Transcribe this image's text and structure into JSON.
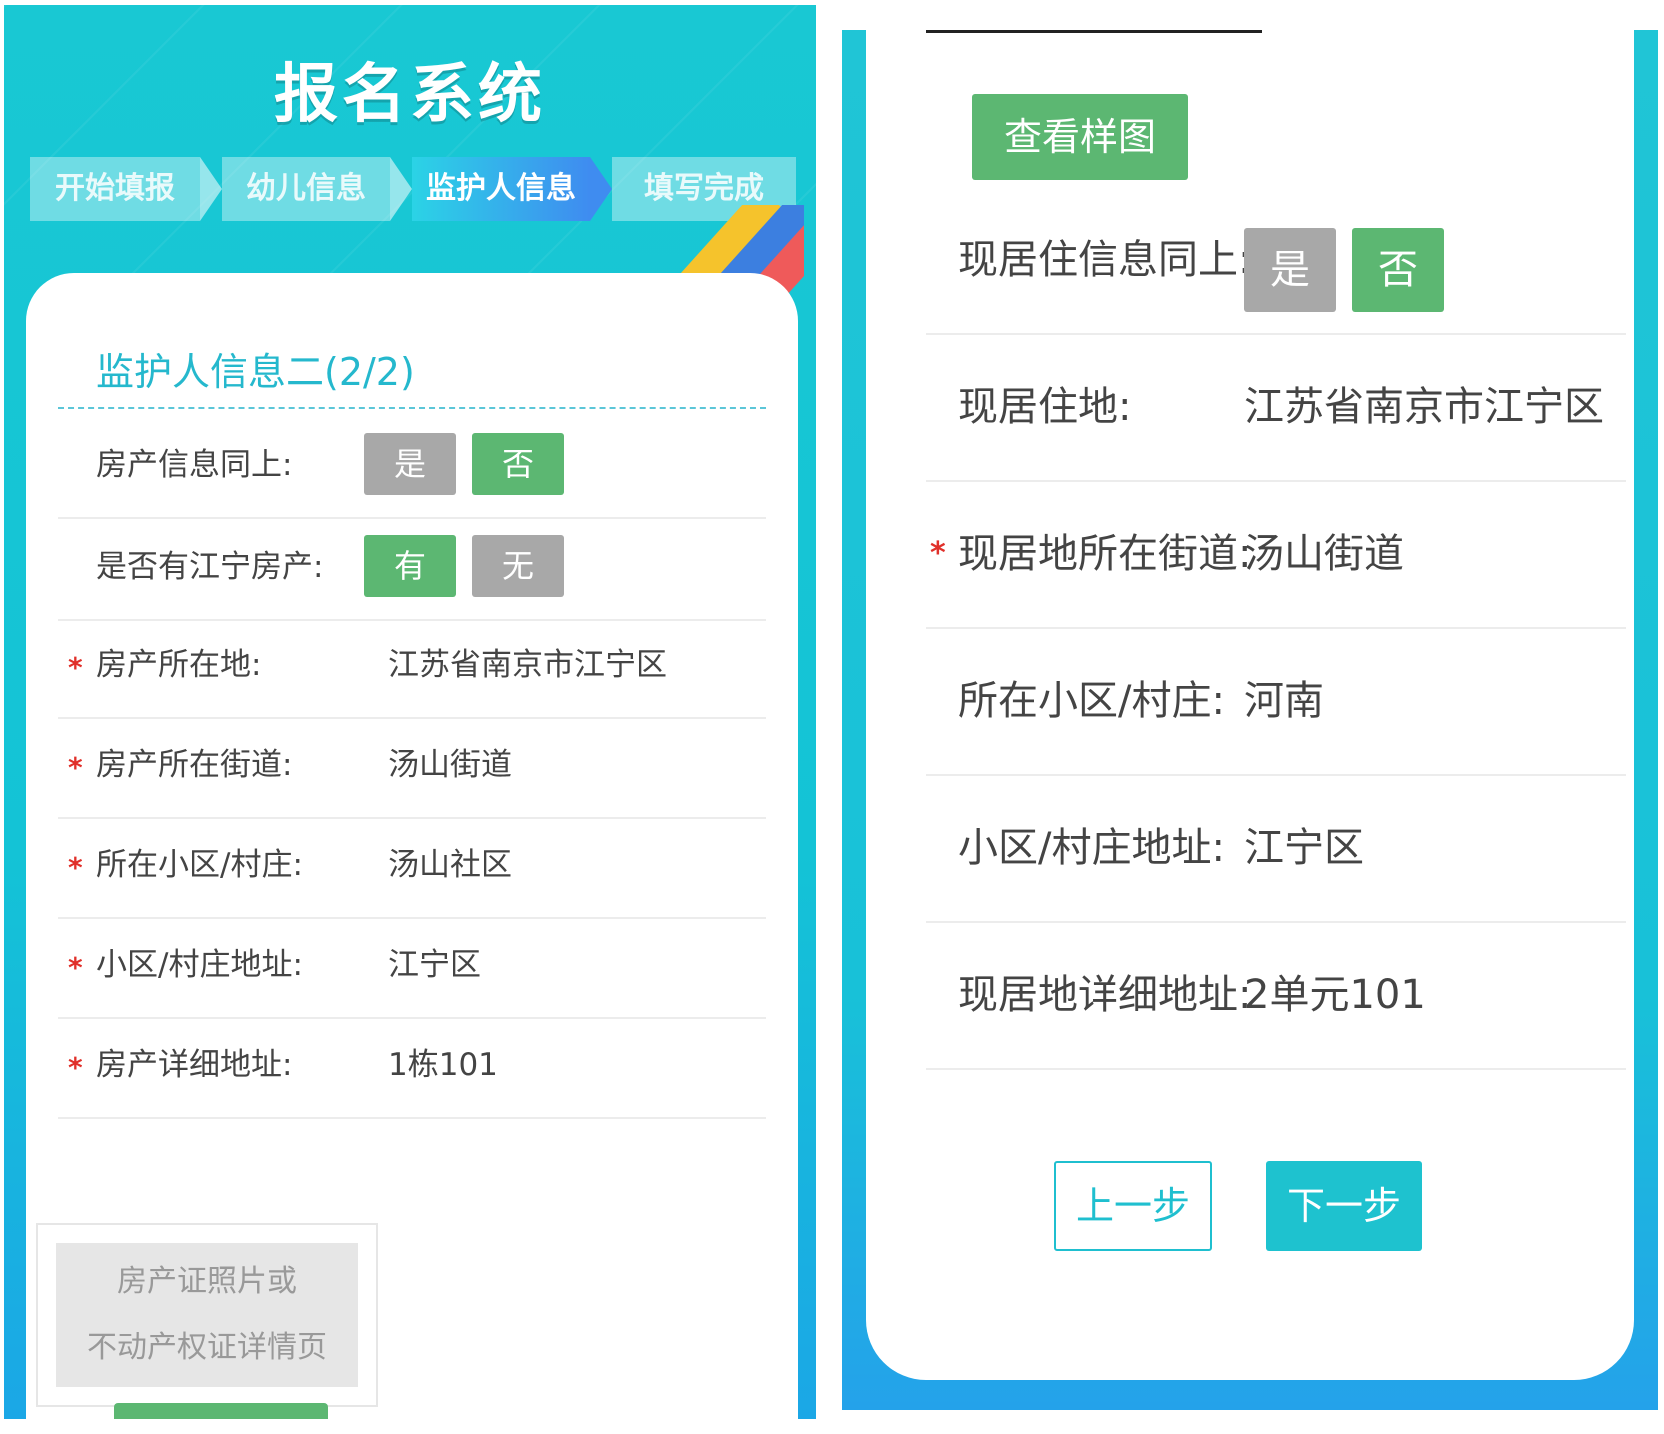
{
  "left": {
    "app_title": "报名系统",
    "steps": [
      {
        "label": "开始填报"
      },
      {
        "label": "幼儿信息"
      },
      {
        "label": "监护人信息"
      },
      {
        "label": "填写完成"
      }
    ],
    "section_title": "监护人信息二(2/2)",
    "property_same": {
      "label": "房产信息同上:",
      "yes": "是",
      "no": "否"
    },
    "has_jiangning_property": {
      "label": "是否有江宁房产:",
      "yes": "有",
      "no": "无"
    },
    "fields": [
      {
        "label": "房产所在地:",
        "value": "江苏省南京市江宁区",
        "required": true
      },
      {
        "label": "房产所在街道:",
        "value": "汤山街道",
        "required": true
      },
      {
        "label": "所在小区/村庄:",
        "value": "汤山社区",
        "required": true
      },
      {
        "label": "小区/村庄地址:",
        "value": "江宁区",
        "required": true
      },
      {
        "label": "房产详细地址:",
        "value": "1栋101",
        "required": true
      }
    ],
    "upload": {
      "line1": "房产证照片或",
      "line2": "不动产权证详情页"
    },
    "required_mark": "*"
  },
  "right": {
    "sample_button": "查看样图",
    "residence_same": {
      "label": "现居住信息同上:",
      "yes": "是",
      "no": "否"
    },
    "fields": [
      {
        "label": "现居住地:",
        "value": "江苏省南京市江宁区",
        "required": false
      },
      {
        "label": "现居地所在街道:",
        "value": "汤山街道",
        "required": true
      },
      {
        "label": "所在小区/村庄:",
        "value": "河南",
        "required": false
      },
      {
        "label": "小区/村庄地址:",
        "value": "江宁区",
        "required": false
      },
      {
        "label": "现居地详细地址:",
        "value": "2单元101",
        "required": false
      }
    ],
    "prev_button": "上一步",
    "next_button": "下一步",
    "required_mark": "*"
  },
  "colors": {
    "teal": "#19c8d3",
    "green": "#5cb772",
    "gray": "#a8a8a8",
    "required_red": "#e0302a",
    "title_blue": "#25b8cd"
  }
}
